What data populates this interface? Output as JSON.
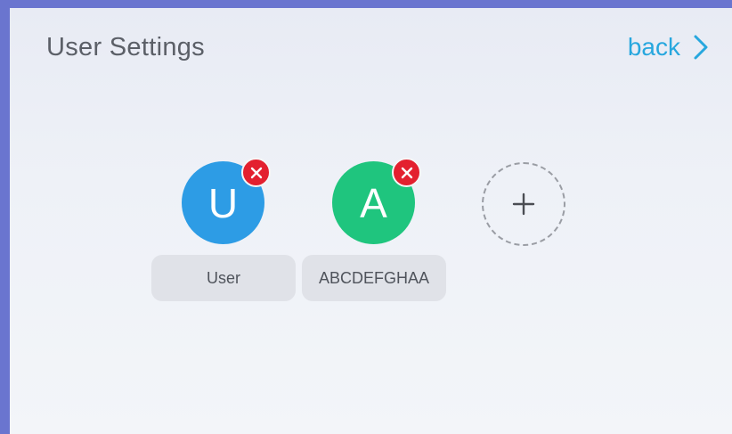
{
  "header": {
    "title": "User Settings",
    "back_label": "back",
    "accent_color": "#27a7de"
  },
  "users": [
    {
      "initial": "U",
      "name": "User",
      "color": "#2d9ce5"
    },
    {
      "initial": "A",
      "name": "ABCDEFGHAA",
      "color": "#1fc57e"
    }
  ],
  "actions": {
    "remove_icon": "close-icon",
    "remove_color": "#e3202f",
    "add_icon": "plus-icon"
  }
}
